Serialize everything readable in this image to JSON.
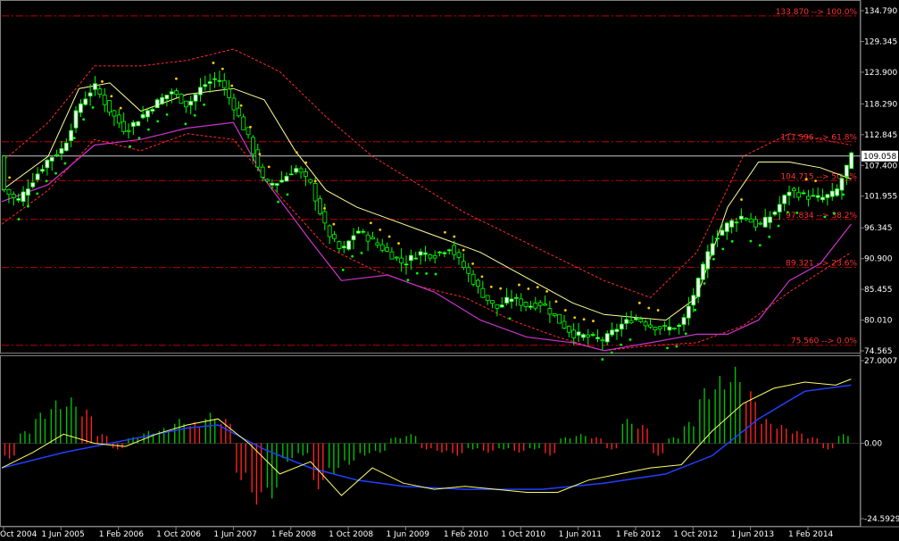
{
  "colors": {
    "background": "#000000",
    "bull_candle": "#ffffff",
    "bear_candle": "#000000",
    "wick": "#00ff00",
    "fib_line": "#c00000",
    "fib_label": "#ff3030",
    "bollinger_outer": "#ff2a2a",
    "bollinger_mid": "#ffff99",
    "envelope_magenta": "#cc33cc",
    "trail_green": "#00ff00",
    "trail_yellow": "#ffcc00",
    "current_price_line": "#c8c8c8",
    "osc_up_bar": "#00c000",
    "osc_down_bar": "#ff2020",
    "osc_signal": "#ffff66",
    "osc_base": "#2040ff",
    "axis_text": "#ffffff"
  },
  "chart_data": [
    {
      "type": "candlestick",
      "panel": "price",
      "ylim": [
        74.565,
        134.79
      ],
      "y_ticks": [
        "134.790",
        "129.345",
        "123.900",
        "118.290",
        "112.845",
        "107.400",
        "101.955",
        "96.345",
        "90.900",
        "85.455",
        "80.010",
        "74.565"
      ],
      "y_tick_values": [
        134.79,
        129.345,
        123.9,
        118.29,
        112.845,
        107.4,
        101.955,
        96.345,
        90.9,
        85.455,
        80.01,
        74.565
      ],
      "x_ticks": [
        "Oct 2004",
        "1 Jun 2005",
        "1 Feb 2006",
        "1 Oct 2006",
        "1 Jun 2007",
        "1 Feb 2008",
        "1 Oct 2008",
        "1 Jun 2009",
        "1 Feb 2010",
        "1 Oct 2010",
        "1 Jun 2011",
        "1 Feb 2012",
        "1 Oct 2012",
        "1 Jun 2013",
        "1 Feb 2014"
      ],
      "current_price": {
        "label": "109.058",
        "value": 109.058
      },
      "fib_levels": [
        {
          "value": 133.87,
          "label": "133.870 --> 100.0%"
        },
        {
          "value": 111.596,
          "label": "111.596 --> 61.8%"
        },
        {
          "value": 104.715,
          "label": "104.715 --> 50.0%"
        },
        {
          "value": 97.834,
          "label": "97.834 --> 38.2%"
        },
        {
          "value": 89.321,
          "label": "89.321 --> 23.6%"
        },
        {
          "value": 75.56,
          "label": "75.560 --> 0.0%"
        }
      ],
      "price_series": [
        {
          "x": 0,
          "y": 103.5
        },
        {
          "x": 2,
          "y": 101.0
        },
        {
          "x": 4,
          "y": 104.8
        },
        {
          "x": 6,
          "y": 108.5
        },
        {
          "x": 8,
          "y": 110.5
        },
        {
          "x": 10,
          "y": 118.0
        },
        {
          "x": 12,
          "y": 121.5
        },
        {
          "x": 14,
          "y": 117.0
        },
        {
          "x": 16,
          "y": 113.5
        },
        {
          "x": 18,
          "y": 116.0
        },
        {
          "x": 20,
          "y": 118.5
        },
        {
          "x": 22,
          "y": 120.5
        },
        {
          "x": 24,
          "y": 118.0
        },
        {
          "x": 26,
          "y": 121.5
        },
        {
          "x": 28,
          "y": 123.0
        },
        {
          "x": 30,
          "y": 118.0
        },
        {
          "x": 32,
          "y": 112.0
        },
        {
          "x": 34,
          "y": 104.0
        },
        {
          "x": 36,
          "y": 104.5
        },
        {
          "x": 38,
          "y": 107.0
        },
        {
          "x": 40,
          "y": 104.0
        },
        {
          "x": 42,
          "y": 96.0
        },
        {
          "x": 44,
          "y": 92.0
        },
        {
          "x": 46,
          "y": 96.0
        },
        {
          "x": 48,
          "y": 94.0
        },
        {
          "x": 50,
          "y": 92.0
        },
        {
          "x": 52,
          "y": 90.0
        },
        {
          "x": 54,
          "y": 92.0
        },
        {
          "x": 56,
          "y": 91.5
        },
        {
          "x": 58,
          "y": 93.0
        },
        {
          "x": 60,
          "y": 89.0
        },
        {
          "x": 62,
          "y": 85.0
        },
        {
          "x": 64,
          "y": 82.0
        },
        {
          "x": 66,
          "y": 84.0
        },
        {
          "x": 68,
          "y": 82.5
        },
        {
          "x": 70,
          "y": 83.0
        },
        {
          "x": 72,
          "y": 80.0
        },
        {
          "x": 74,
          "y": 77.5
        },
        {
          "x": 76,
          "y": 77.0
        },
        {
          "x": 78,
          "y": 76.5
        },
        {
          "x": 80,
          "y": 79.0
        },
        {
          "x": 82,
          "y": 80.5
        },
        {
          "x": 84,
          "y": 79.0
        },
        {
          "x": 86,
          "y": 78.5
        },
        {
          "x": 88,
          "y": 79.0
        },
        {
          "x": 90,
          "y": 86.0
        },
        {
          "x": 92,
          "y": 94.0
        },
        {
          "x": 94,
          "y": 97.0
        },
        {
          "x": 96,
          "y": 98.5
        },
        {
          "x": 98,
          "y": 96.5
        },
        {
          "x": 100,
          "y": 99.0
        },
        {
          "x": 102,
          "y": 103.0
        },
        {
          "x": 104,
          "y": 102.0
        },
        {
          "x": 106,
          "y": 101.5
        },
        {
          "x": 108,
          "y": 102.5
        },
        {
          "x": 110,
          "y": 109.0
        }
      ],
      "bollinger_mid": [
        {
          "x": 0,
          "y": 103
        },
        {
          "x": 6,
          "y": 109
        },
        {
          "x": 10,
          "y": 121
        },
        {
          "x": 14,
          "y": 122
        },
        {
          "x": 18,
          "y": 117
        },
        {
          "x": 24,
          "y": 120
        },
        {
          "x": 30,
          "y": 121
        },
        {
          "x": 34,
          "y": 119
        },
        {
          "x": 38,
          "y": 110
        },
        {
          "x": 42,
          "y": 103
        },
        {
          "x": 46,
          "y": 100
        },
        {
          "x": 50,
          "y": 98
        },
        {
          "x": 54,
          "y": 96
        },
        {
          "x": 58,
          "y": 94
        },
        {
          "x": 62,
          "y": 92
        },
        {
          "x": 66,
          "y": 89
        },
        {
          "x": 70,
          "y": 86
        },
        {
          "x": 74,
          "y": 83
        },
        {
          "x": 78,
          "y": 81
        },
        {
          "x": 82,
          "y": 80.5
        },
        {
          "x": 86,
          "y": 80
        },
        {
          "x": 90,
          "y": 84
        },
        {
          "x": 94,
          "y": 100
        },
        {
          "x": 98,
          "y": 108
        },
        {
          "x": 102,
          "y": 108
        },
        {
          "x": 106,
          "y": 107
        },
        {
          "x": 110,
          "y": 105
        }
      ],
      "bollinger_upper": [
        {
          "x": 0,
          "y": 108
        },
        {
          "x": 6,
          "y": 115
        },
        {
          "x": 12,
          "y": 125
        },
        {
          "x": 18,
          "y": 125
        },
        {
          "x": 24,
          "y": 126
        },
        {
          "x": 30,
          "y": 128
        },
        {
          "x": 36,
          "y": 124
        },
        {
          "x": 42,
          "y": 116
        },
        {
          "x": 48,
          "y": 109
        },
        {
          "x": 54,
          "y": 104
        },
        {
          "x": 60,
          "y": 99
        },
        {
          "x": 66,
          "y": 95
        },
        {
          "x": 72,
          "y": 91
        },
        {
          "x": 78,
          "y": 87
        },
        {
          "x": 84,
          "y": 84
        },
        {
          "x": 90,
          "y": 92
        },
        {
          "x": 96,
          "y": 109
        },
        {
          "x": 102,
          "y": 113
        },
        {
          "x": 110,
          "y": 111
        }
      ],
      "bollinger_lower": [
        {
          "x": 0,
          "y": 97
        },
        {
          "x": 6,
          "y": 103
        },
        {
          "x": 12,
          "y": 112
        },
        {
          "x": 18,
          "y": 110
        },
        {
          "x": 24,
          "y": 113
        },
        {
          "x": 30,
          "y": 112
        },
        {
          "x": 36,
          "y": 102
        },
        {
          "x": 42,
          "y": 93
        },
        {
          "x": 48,
          "y": 89
        },
        {
          "x": 54,
          "y": 86
        },
        {
          "x": 60,
          "y": 84
        },
        {
          "x": 66,
          "y": 80
        },
        {
          "x": 72,
          "y": 77
        },
        {
          "x": 78,
          "y": 74.6
        },
        {
          "x": 84,
          "y": 75.5
        },
        {
          "x": 90,
          "y": 76
        },
        {
          "x": 96,
          "y": 79
        },
        {
          "x": 102,
          "y": 85
        },
        {
          "x": 110,
          "y": 92
        }
      ],
      "magenta_envelope": [
        {
          "x": 0,
          "y": 101
        },
        {
          "x": 6,
          "y": 104
        },
        {
          "x": 12,
          "y": 111
        },
        {
          "x": 18,
          "y": 112
        },
        {
          "x": 24,
          "y": 114
        },
        {
          "x": 30,
          "y": 115
        },
        {
          "x": 34,
          "y": 105
        },
        {
          "x": 40,
          "y": 94
        },
        {
          "x": 44,
          "y": 87
        },
        {
          "x": 50,
          "y": 88
        },
        {
          "x": 56,
          "y": 85
        },
        {
          "x": 62,
          "y": 80
        },
        {
          "x": 68,
          "y": 77
        },
        {
          "x": 74,
          "y": 76
        },
        {
          "x": 78,
          "y": 74.6
        },
        {
          "x": 84,
          "y": 76
        },
        {
          "x": 90,
          "y": 77.5
        },
        {
          "x": 94,
          "y": 77.5
        },
        {
          "x": 98,
          "y": 80
        },
        {
          "x": 102,
          "y": 87
        },
        {
          "x": 106,
          "y": 90
        },
        {
          "x": 110,
          "y": 97
        }
      ]
    },
    {
      "type": "histogram+lines",
      "panel": "oscillator",
      "ylim": [
        -24.5929,
        27.0007
      ],
      "y_ticks": [
        "27.0007",
        "0.00",
        "-24.5929"
      ],
      "y_tick_values": [
        27.0007,
        0,
        -24.5929
      ],
      "bars": [
        {
          "x": 1,
          "y": -5
        },
        {
          "x": 3,
          "y": 4
        },
        {
          "x": 5,
          "y": 10
        },
        {
          "x": 7,
          "y": 14
        },
        {
          "x": 9,
          "y": 15
        },
        {
          "x": 11,
          "y": 11
        },
        {
          "x": 13,
          "y": 3
        },
        {
          "x": 15,
          "y": -2
        },
        {
          "x": 17,
          "y": 2
        },
        {
          "x": 19,
          "y": 4
        },
        {
          "x": 21,
          "y": 5
        },
        {
          "x": 23,
          "y": 8
        },
        {
          "x": 25,
          "y": 7
        },
        {
          "x": 27,
          "y": 10
        },
        {
          "x": 29,
          "y": 8
        },
        {
          "x": 31,
          "y": -12
        },
        {
          "x": 33,
          "y": -20
        },
        {
          "x": 35,
          "y": -18
        },
        {
          "x": 37,
          "y": -6
        },
        {
          "x": 39,
          "y": -4
        },
        {
          "x": 41,
          "y": -15
        },
        {
          "x": 43,
          "y": -10
        },
        {
          "x": 45,
          "y": -7
        },
        {
          "x": 47,
          "y": -4
        },
        {
          "x": 49,
          "y": -3
        },
        {
          "x": 51,
          "y": 2
        },
        {
          "x": 53,
          "y": 3
        },
        {
          "x": 55,
          "y": -2
        },
        {
          "x": 57,
          "y": -3
        },
        {
          "x": 59,
          "y": -4
        },
        {
          "x": 61,
          "y": -2
        },
        {
          "x": 63,
          "y": -3
        },
        {
          "x": 65,
          "y": -2
        },
        {
          "x": 67,
          "y": -3
        },
        {
          "x": 69,
          "y": -2
        },
        {
          "x": 71,
          "y": -4
        },
        {
          "x": 73,
          "y": 2
        },
        {
          "x": 75,
          "y": 3
        },
        {
          "x": 77,
          "y": 2
        },
        {
          "x": 79,
          "y": -2
        },
        {
          "x": 81,
          "y": 8
        },
        {
          "x": 83,
          "y": 6
        },
        {
          "x": 85,
          "y": -4
        },
        {
          "x": 87,
          "y": 2
        },
        {
          "x": 89,
          "y": 7
        },
        {
          "x": 91,
          "y": 18
        },
        {
          "x": 93,
          "y": 22
        },
        {
          "x": 95,
          "y": 25
        },
        {
          "x": 97,
          "y": 17
        },
        {
          "x": 99,
          "y": 8
        },
        {
          "x": 101,
          "y": 6
        },
        {
          "x": 103,
          "y": 4
        },
        {
          "x": 105,
          "y": 2
        },
        {
          "x": 107,
          "y": -2
        },
        {
          "x": 109,
          "y": 3
        }
      ],
      "signal_line": [
        {
          "x": 0,
          "y": -8
        },
        {
          "x": 4,
          "y": -3
        },
        {
          "x": 8,
          "y": 3
        },
        {
          "x": 12,
          "y": 0
        },
        {
          "x": 16,
          "y": -1
        },
        {
          "x": 20,
          "y": 3
        },
        {
          "x": 24,
          "y": 6
        },
        {
          "x": 28,
          "y": 8
        },
        {
          "x": 32,
          "y": 0
        },
        {
          "x": 36,
          "y": -10
        },
        {
          "x": 40,
          "y": -6
        },
        {
          "x": 44,
          "y": -17
        },
        {
          "x": 48,
          "y": -8
        },
        {
          "x": 52,
          "y": -13
        },
        {
          "x": 56,
          "y": -15
        },
        {
          "x": 60,
          "y": -14
        },
        {
          "x": 64,
          "y": -15
        },
        {
          "x": 68,
          "y": -16
        },
        {
          "x": 72,
          "y": -16
        },
        {
          "x": 76,
          "y": -12
        },
        {
          "x": 80,
          "y": -10
        },
        {
          "x": 84,
          "y": -8
        },
        {
          "x": 88,
          "y": -7
        },
        {
          "x": 92,
          "y": 4
        },
        {
          "x": 96,
          "y": 13
        },
        {
          "x": 100,
          "y": 18
        },
        {
          "x": 104,
          "y": 20
        },
        {
          "x": 108,
          "y": 19
        },
        {
          "x": 110,
          "y": 21
        }
      ],
      "base_line": [
        {
          "x": 0,
          "y": -8
        },
        {
          "x": 8,
          "y": -3
        },
        {
          "x": 16,
          "y": 1
        },
        {
          "x": 24,
          "y": 5
        },
        {
          "x": 28,
          "y": 6
        },
        {
          "x": 34,
          "y": -2
        },
        {
          "x": 40,
          "y": -8
        },
        {
          "x": 46,
          "y": -12
        },
        {
          "x": 52,
          "y": -14
        },
        {
          "x": 60,
          "y": -15
        },
        {
          "x": 70,
          "y": -15
        },
        {
          "x": 78,
          "y": -13
        },
        {
          "x": 86,
          "y": -10
        },
        {
          "x": 92,
          "y": -4
        },
        {
          "x": 98,
          "y": 8
        },
        {
          "x": 104,
          "y": 17
        },
        {
          "x": 110,
          "y": 19
        }
      ]
    }
  ]
}
